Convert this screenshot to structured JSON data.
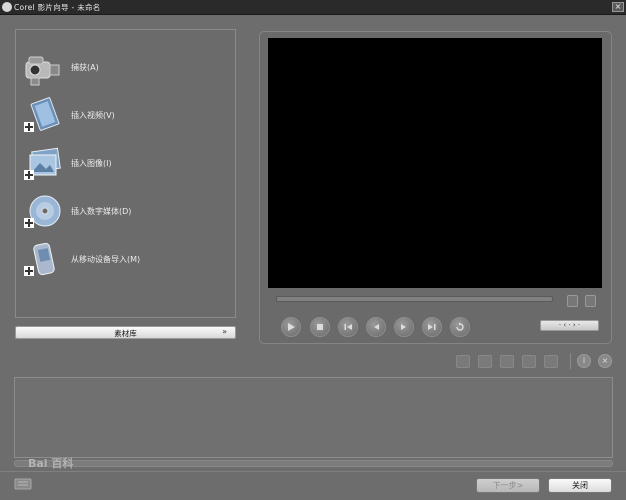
{
  "window": {
    "title": "Corel 影片向导 - 未命名",
    "close_glyph": "×"
  },
  "left_panel": {
    "items": [
      {
        "label": "捕获(A)",
        "icon": "camcorder-icon"
      },
      {
        "label": "插入视频(V)",
        "icon": "insert-video-icon"
      },
      {
        "label": "插入图像(I)",
        "icon": "insert-image-icon"
      },
      {
        "label": "插入数字媒体(D)",
        "icon": "insert-disc-icon"
      },
      {
        "label": "从移动设备导入(M)",
        "icon": "mobile-device-icon"
      }
    ],
    "library_label": "素材库",
    "library_chevron": "»"
  },
  "preview": {
    "timecode": "· ‹ · › ·"
  },
  "toolbar": {
    "info_glyph": "i",
    "close_glyph": "×"
  },
  "footer": {
    "next_label": "下一步>",
    "close_label": "关闭",
    "watermark": "Bai 百科"
  }
}
